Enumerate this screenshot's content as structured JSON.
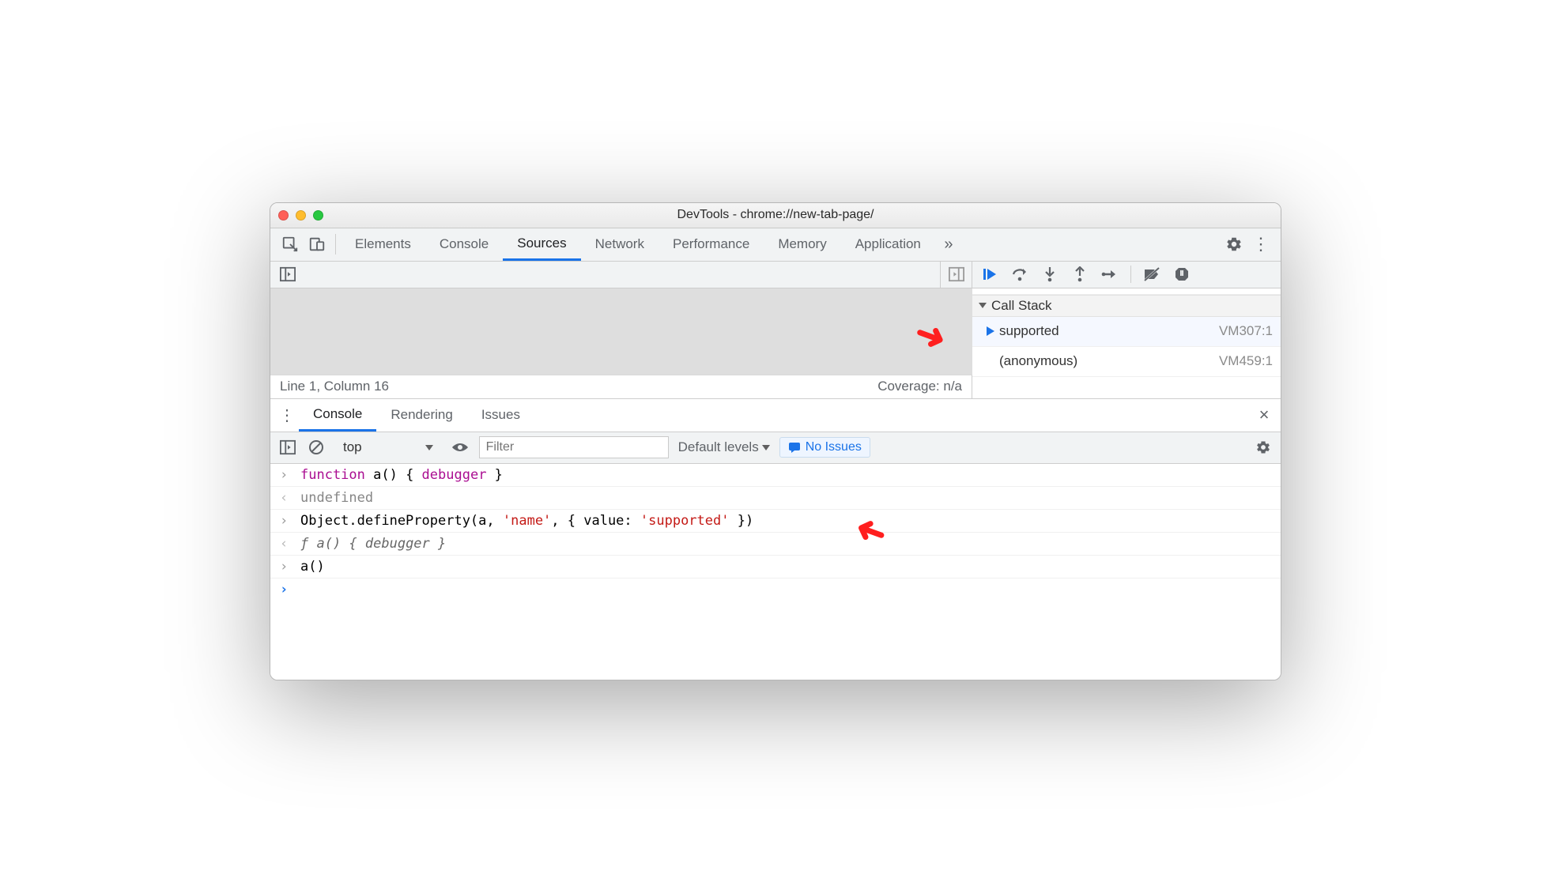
{
  "window": {
    "title": "DevTools - chrome://new-tab-page/"
  },
  "mainTabs": {
    "items": [
      "Elements",
      "Console",
      "Sources",
      "Network",
      "Performance",
      "Memory",
      "Application"
    ],
    "activeIndex": 2
  },
  "sources": {
    "status": {
      "position": "Line 1, Column 16",
      "coverage": "Coverage: n/a"
    },
    "callstack": {
      "header": "Call Stack",
      "frames": [
        {
          "name": "supported",
          "location": "VM307:1",
          "active": true
        },
        {
          "name": "(anonymous)",
          "location": "VM459:1",
          "active": false
        }
      ]
    }
  },
  "drawer": {
    "tabs": [
      "Console",
      "Rendering",
      "Issues"
    ],
    "activeIndex": 0
  },
  "consoleToolbar": {
    "context": "top",
    "filterPlaceholder": "Filter",
    "levels": "Default levels",
    "issues": "No Issues"
  },
  "consoleLines": {
    "l0a": "function",
    "l0b": " a() { ",
    "l0c": "debugger",
    "l0d": " }",
    "l1": "undefined",
    "l2a": "Object.defineProperty(a, ",
    "l2b": "'name'",
    "l2c": ", { value: ",
    "l2d": "'supported'",
    "l2e": " })",
    "l3a": "ƒ ",
    "l3b": "a() { debugger }",
    "l4": "a()"
  }
}
